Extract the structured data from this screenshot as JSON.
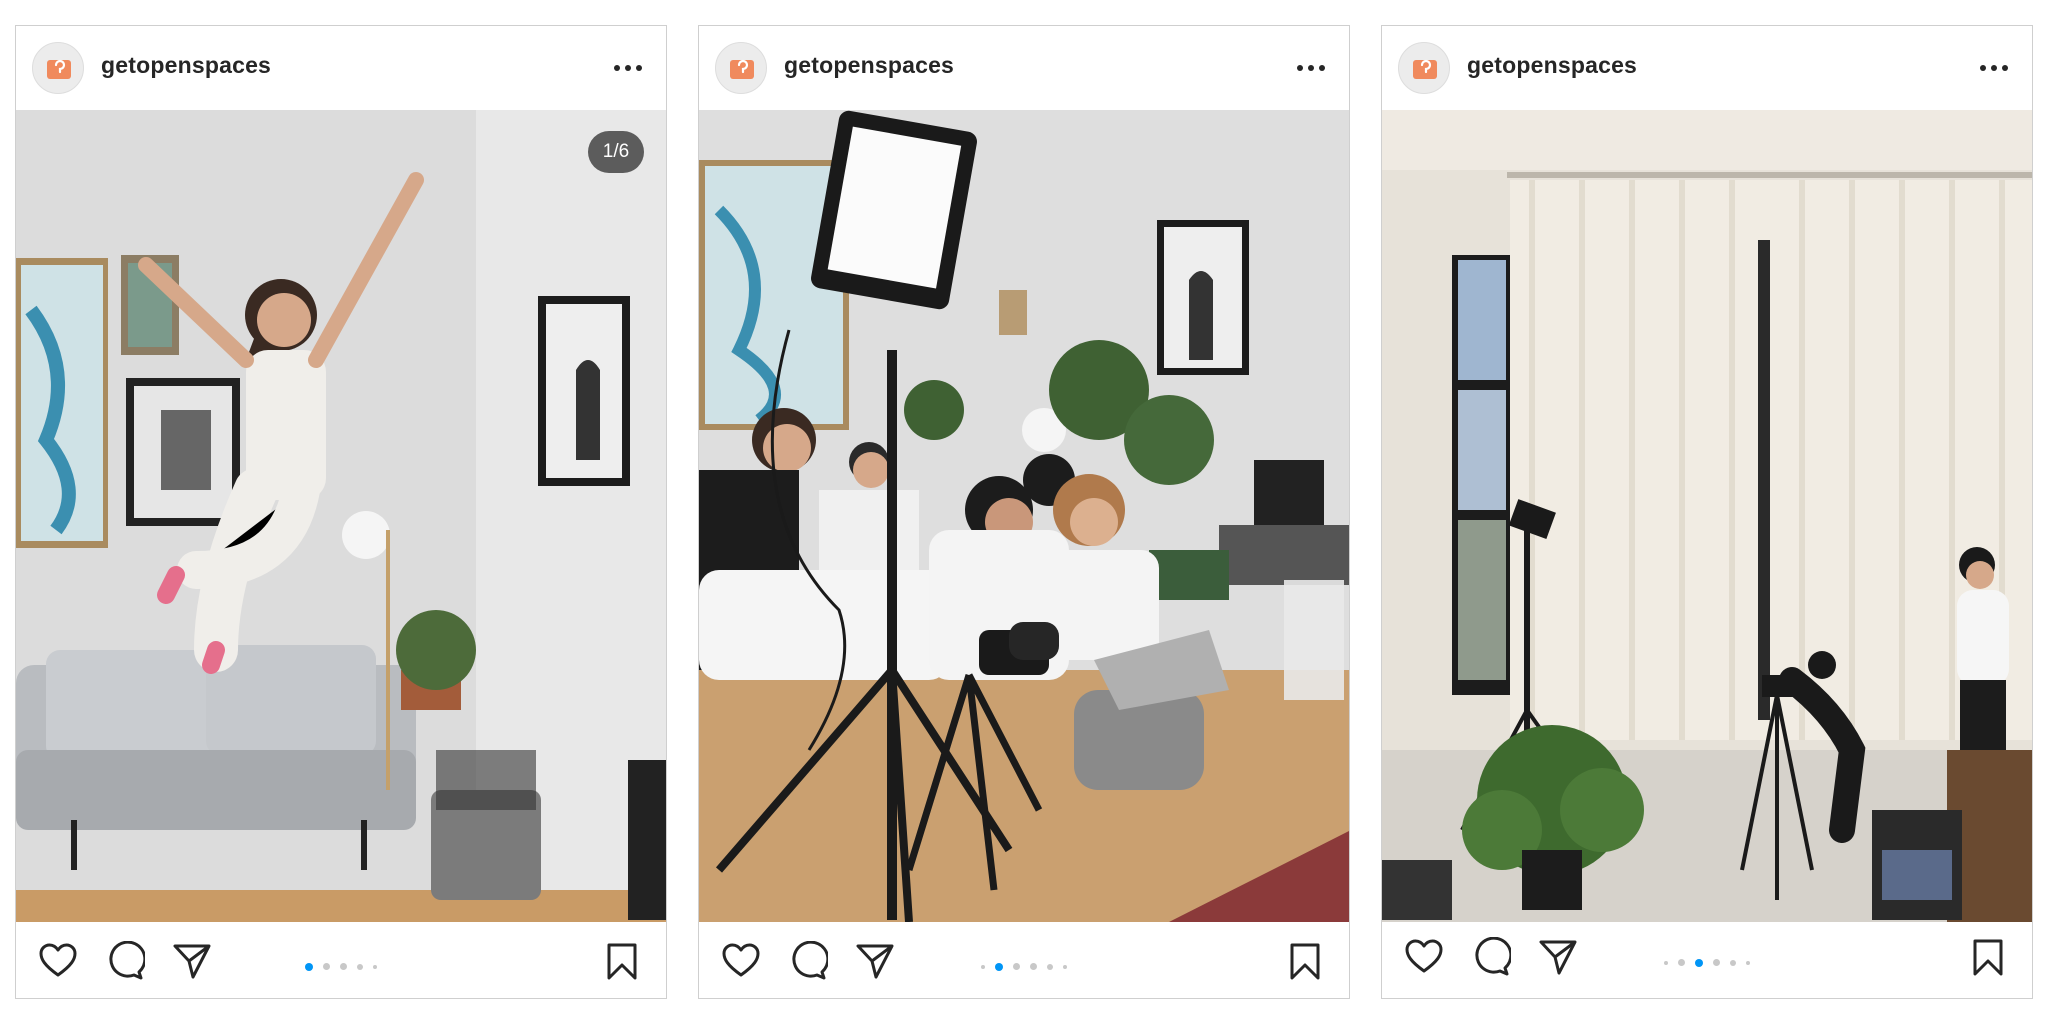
{
  "posts": [
    {
      "username": "getopenspaces",
      "counter": "1/6",
      "active_dot": 0,
      "image_alt": "Woman jumping in white overalls in a living room",
      "dots": 5
    },
    {
      "username": "getopenspaces",
      "counter": "",
      "active_dot": 1,
      "image_alt": "Photo shoot with a panel light and camera on tripod",
      "dots": 6
    },
    {
      "username": "getopenspaces",
      "counter": "",
      "active_dot": 2,
      "image_alt": "Loft with sheer curtains and a photographer with tripod",
      "dots": 6
    }
  ],
  "icons": {
    "like": "heart-icon",
    "comment": "comment-icon",
    "share": "send-icon",
    "save": "bookmark-icon",
    "more": "more-dots-icon"
  },
  "colors": {
    "accent": "#0095f6",
    "avatar_brand": "#f08a5d"
  }
}
